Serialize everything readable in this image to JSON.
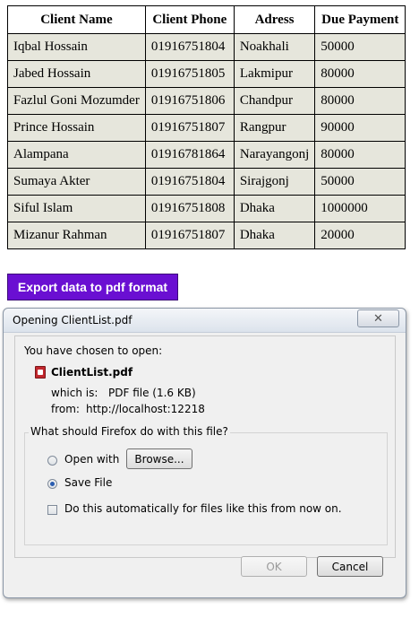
{
  "table": {
    "headers": [
      "Client Name",
      "Client Phone",
      "Adress",
      "Due Payment"
    ],
    "rows": [
      [
        "Iqbal Hossain",
        "01916751804",
        "Noakhali",
        "50000"
      ],
      [
        "Jabed Hossain",
        "01916751805",
        "Lakmipur",
        "80000"
      ],
      [
        "Fazlul Goni Mozumder",
        "01916751806",
        "Chandpur",
        "80000"
      ],
      [
        "Prince Hossain",
        "01916751807",
        "Rangpur",
        "90000"
      ],
      [
        "Alampana",
        "01916781864",
        "Narayangonj",
        "80000"
      ],
      [
        "Sumaya Akter",
        "01916751804",
        "Sirajgonj",
        "50000"
      ],
      [
        "Siful Islam",
        "01916751808",
        "Dhaka",
        "1000000"
      ],
      [
        "Mizanur Rahman",
        "01916751807",
        "Dhaka",
        "20000"
      ]
    ]
  },
  "export_button": {
    "label": "Export data to pdf format",
    "color": "#6a0fd2"
  },
  "dialog": {
    "title": "Opening ClientList.pdf",
    "close_icon": "close-icon",
    "intro": "You have chosen to open:",
    "file_icon": "pdf-file-icon",
    "file_name": "ClientList.pdf",
    "which_is_label": "which is:",
    "which_is_value": "PDF file (1.6 KB)",
    "from_label": "from:",
    "from_value": "http://localhost:12218",
    "question": "What should Firefox do with this file?",
    "open_with_label": "Open with",
    "browse_label": "Browse...",
    "save_file_label": "Save File",
    "auto_label": "Do this automatically for files like this from now on.",
    "selected_option": "Save File",
    "ok_label": "OK",
    "cancel_label": "Cancel"
  }
}
